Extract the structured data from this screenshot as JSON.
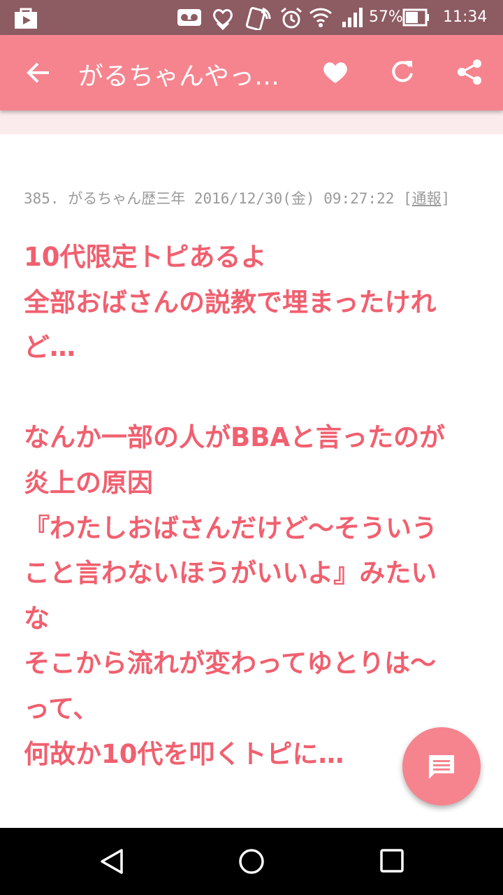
{
  "status_bar": {
    "battery_percent": "57%",
    "time": "11:34",
    "icons": [
      "store-icon",
      "voicemail-icon",
      "heart-hands-icon",
      "nfc-icon",
      "alarm-icon",
      "wifi-icon",
      "signal-icon",
      "battery-icon"
    ]
  },
  "toolbar": {
    "title": "がるちゃんやっ…",
    "icons": [
      "back-arrow-icon",
      "heart-icon",
      "refresh-icon",
      "share-icon"
    ],
    "color": "#f5848f"
  },
  "comment": {
    "meta_prefix": "385. がるちゃん歴三年 2016/12/30(金) 09:27:22 [",
    "report_label": "通報",
    "meta_suffix": "]",
    "lines": [
      "10代限定トピあるよ",
      "全部おばさんの説教で埋まったけれ",
      "ど…",
      "",
      "なんか一部の人がBBAと言ったのが",
      "炎上の原因",
      "『わたしおばさんだけど～そういう",
      "こと言わないほうがいいよ』みたい",
      "な",
      "そこから流れが変わってゆとりは～",
      "って、",
      "何故か10代を叩くトピに…"
    ],
    "text_color": "#f0606f"
  },
  "fab": {
    "icon": "comment-icon"
  },
  "nav_bar": {
    "icons": [
      "back-triangle-icon",
      "home-circle-icon",
      "recents-square-icon"
    ]
  }
}
